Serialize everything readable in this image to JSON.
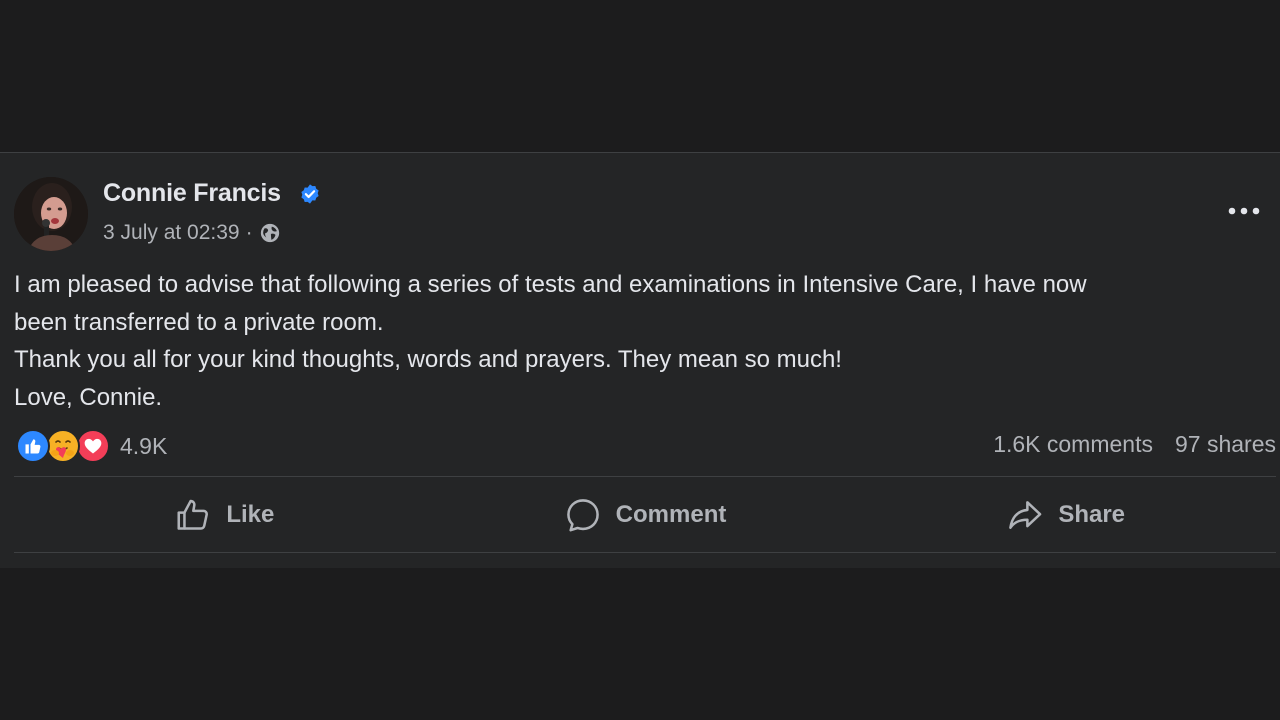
{
  "post": {
    "author": "Connie Francis",
    "timestamp": "3 July at 02:39",
    "separator": "·",
    "privacy_icon": "globe-icon",
    "verified_icon": "verified-badge-icon",
    "more_icon": "more-options-icon",
    "more_label": "•••",
    "body": [
      "I am pleased to advise that following a series of tests and examinations in Intensive Care, I have now",
      "been transferred to a private room.",
      "Thank you all for your kind thoughts, words and prayers. They mean so much!",
      "Love, Connie."
    ],
    "reactions": {
      "types": [
        "like-reaction-icon",
        "care-reaction-icon",
        "love-reaction-icon"
      ],
      "count": "4.9K"
    },
    "comments": "1.6K comments",
    "shares": "97 shares",
    "actions": {
      "like": "Like",
      "comment": "Comment",
      "share": "Share"
    }
  },
  "colors": {
    "page_background": "#1c1c1d",
    "card_background": "#242526",
    "primary_text": "#e4e6eb",
    "secondary_text": "#b0b3b8",
    "verified_blue": "#2d88ff",
    "like_blue": "#2d88ff",
    "care_yellow": "#f7b125",
    "love_red": "#f33e58"
  }
}
